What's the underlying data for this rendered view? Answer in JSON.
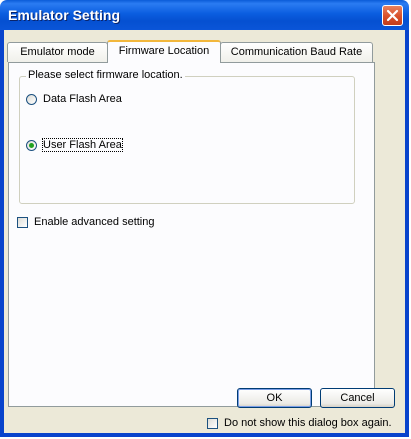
{
  "window": {
    "title": "Emulator Setting"
  },
  "tabs": [
    {
      "label": "Emulator mode",
      "active": false
    },
    {
      "label": "Firmware Location",
      "active": true
    },
    {
      "label": "Communication Baud Rate",
      "active": false
    }
  ],
  "group": {
    "legend": "Please select firmware location.",
    "options": [
      {
        "label": "Data Flash Area",
        "selected": false
      },
      {
        "label": "User Flash Area",
        "selected": true
      }
    ]
  },
  "advanced": {
    "label": "Enable advanced setting",
    "checked": false
  },
  "buttons": {
    "ok": "OK",
    "cancel": "Cancel"
  },
  "dont_show": {
    "label": "Do not show this dialog box again.",
    "checked": false
  },
  "colors": {
    "accent": "#0843cc",
    "tab_highlight": "#f2b73c",
    "radio_selected": "#21a121",
    "close_button": "#d8502a"
  }
}
